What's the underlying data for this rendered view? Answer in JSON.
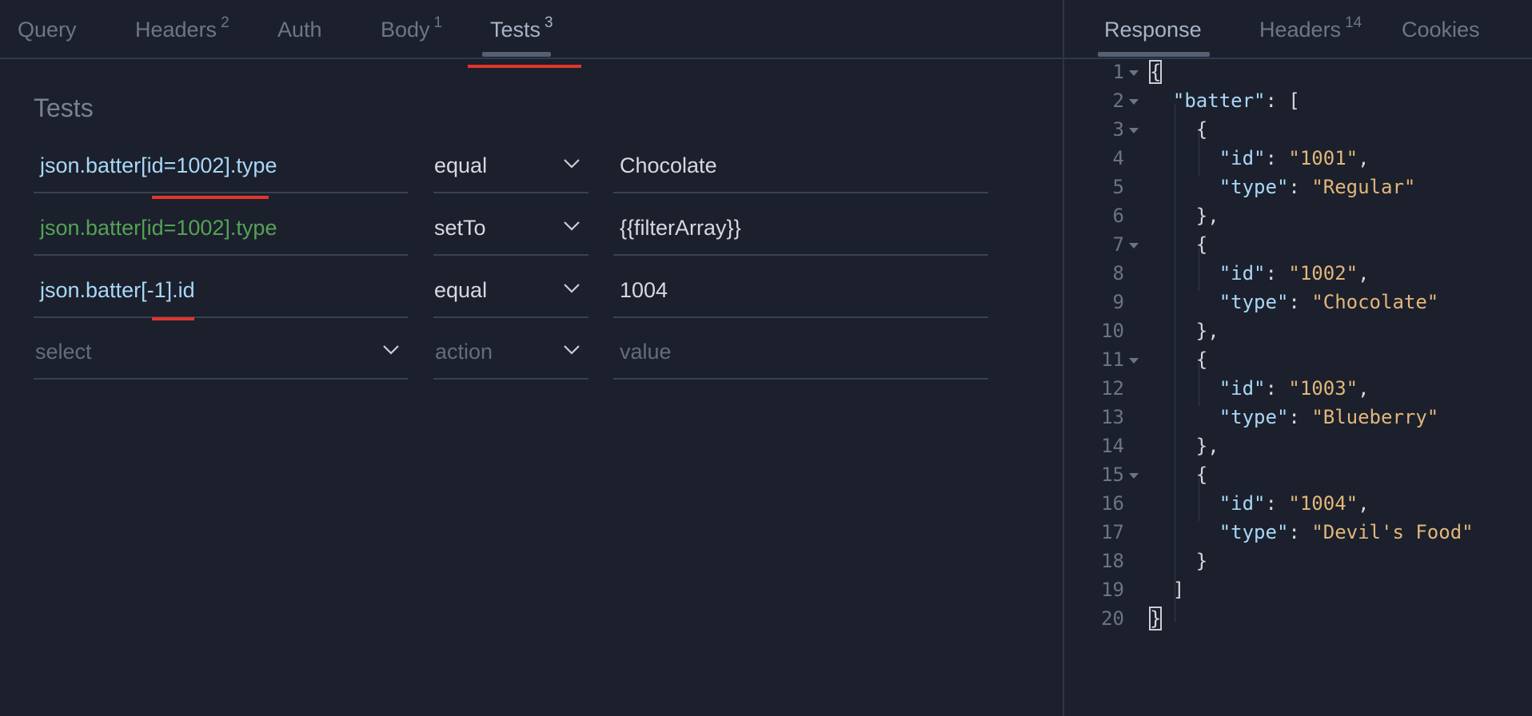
{
  "request_tabs": [
    {
      "label": "Query",
      "count": ""
    },
    {
      "label": "Headers",
      "count": "2"
    },
    {
      "label": "Auth",
      "count": ""
    },
    {
      "label": "Body",
      "count": "1"
    },
    {
      "label": "Tests",
      "count": "3"
    }
  ],
  "response_tabs": [
    {
      "label": "Response",
      "count": ""
    },
    {
      "label": "Headers",
      "count": "14"
    },
    {
      "label": "Cookies",
      "count": ""
    }
  ],
  "tests": {
    "title": "Tests",
    "rows": [
      {
        "query": "json.batter[id=1002].type",
        "action": "equal",
        "value": "Chocolate"
      },
      {
        "query": "json.batter[id=1002].type",
        "action": "setTo",
        "value": "{{filterArray}}"
      },
      {
        "query": "json.batter[-1].id",
        "action": "equal",
        "value": "1004"
      }
    ],
    "new_row": {
      "select_placeholder": "select",
      "action_placeholder": "action",
      "value_placeholder": "value"
    }
  },
  "response_lines": [
    {
      "n": "1",
      "text": "{"
    },
    {
      "n": "2",
      "text": "  \"batter\": ["
    },
    {
      "n": "3",
      "text": "    {"
    },
    {
      "n": "4",
      "text": "      \"id\": \"1001\","
    },
    {
      "n": "5",
      "text": "      \"type\": \"Regular\""
    },
    {
      "n": "6",
      "text": "    },"
    },
    {
      "n": "7",
      "text": "    {"
    },
    {
      "n": "8",
      "text": "      \"id\": \"1002\","
    },
    {
      "n": "9",
      "text": "      \"type\": \"Chocolate\""
    },
    {
      "n": "10",
      "text": "    },"
    },
    {
      "n": "11",
      "text": "    {"
    },
    {
      "n": "12",
      "text": "      \"id\": \"1003\","
    },
    {
      "n": "13",
      "text": "      \"type\": \"Blueberry\""
    },
    {
      "n": "14",
      "text": "    },"
    },
    {
      "n": "15",
      "text": "    {"
    },
    {
      "n": "16",
      "text": "      \"id\": \"1004\","
    },
    {
      "n": "17",
      "text": "      \"type\": \"Devil's Food\""
    },
    {
      "n": "18",
      "text": "    }"
    },
    {
      "n": "19",
      "text": "  ]"
    },
    {
      "n": "20",
      "text": "}"
    }
  ],
  "colors": {
    "background": "#1b202c",
    "query_text": "#a9d7f7",
    "query_text_variable": "#55a256",
    "json_key": "#a9d7f7",
    "json_string": "#e3b679",
    "annotation_red": "#e0362d"
  }
}
